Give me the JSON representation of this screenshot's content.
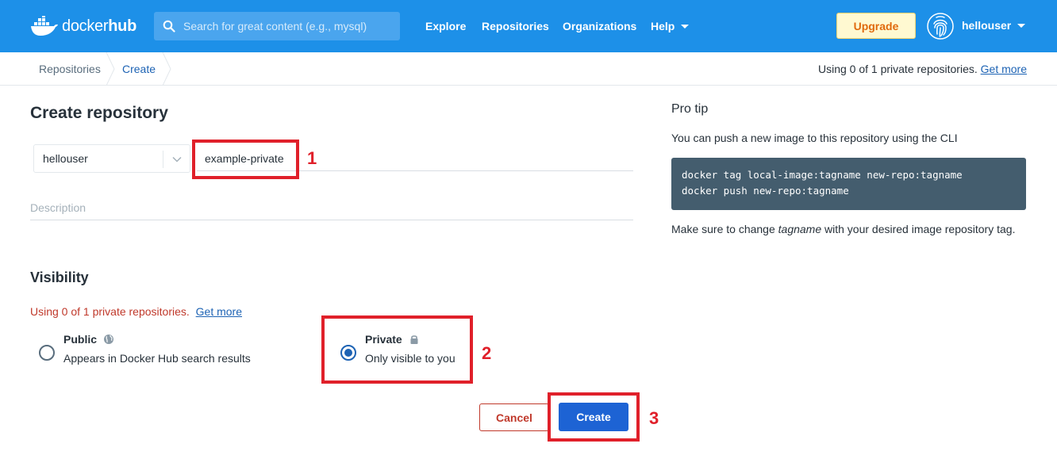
{
  "header": {
    "logo_text_light": "docker",
    "logo_text_bold": "hub",
    "search_placeholder": "Search for great content (e.g., mysql)",
    "nav": {
      "explore": "Explore",
      "repositories": "Repositories",
      "organizations": "Organizations",
      "help": "Help"
    },
    "upgrade_label": "Upgrade",
    "username": "hellouser"
  },
  "breadcrumb": {
    "items": [
      "Repositories",
      "Create"
    ],
    "quota_text": "Using 0 of 1 private repositories.",
    "quota_link": "Get more"
  },
  "form": {
    "title": "Create repository",
    "namespace": "hellouser",
    "repo_name": "example-private",
    "description_placeholder": "Description",
    "visibility_title": "Visibility",
    "quota_warning": "Using 0 of 1 private repositories.",
    "quota_warning_link": "Get more",
    "options": {
      "public": {
        "title": "Public",
        "subtitle": "Appears in Docker Hub search results",
        "selected": false
      },
      "private": {
        "title": "Private",
        "subtitle": "Only visible to you",
        "selected": true
      }
    },
    "cancel_label": "Cancel",
    "create_label": "Create"
  },
  "annotations": {
    "step_1": "1",
    "step_2": "2",
    "step_3": "3"
  },
  "pro_tip": {
    "title": "Pro tip",
    "text": "You can push a new image to this repository using the CLI",
    "code_line_1": "docker tag local-image:tagname new-repo:tagname",
    "code_line_2": "docker push new-repo:tagname",
    "note_before": "Make sure to change ",
    "note_em": "tagname",
    "note_after": " with your desired image repository tag."
  },
  "colors": {
    "header_bg": "#1d90e8",
    "primary": "#1d63d4",
    "danger": "#c0392b",
    "annotation": "#e0202a",
    "code_bg": "#445d6e"
  },
  "icons": {
    "logo": "docker-whale-icon",
    "search": "search-icon",
    "avatar": "fingerprint-icon",
    "public": "globe-icon",
    "private": "lock-icon"
  }
}
